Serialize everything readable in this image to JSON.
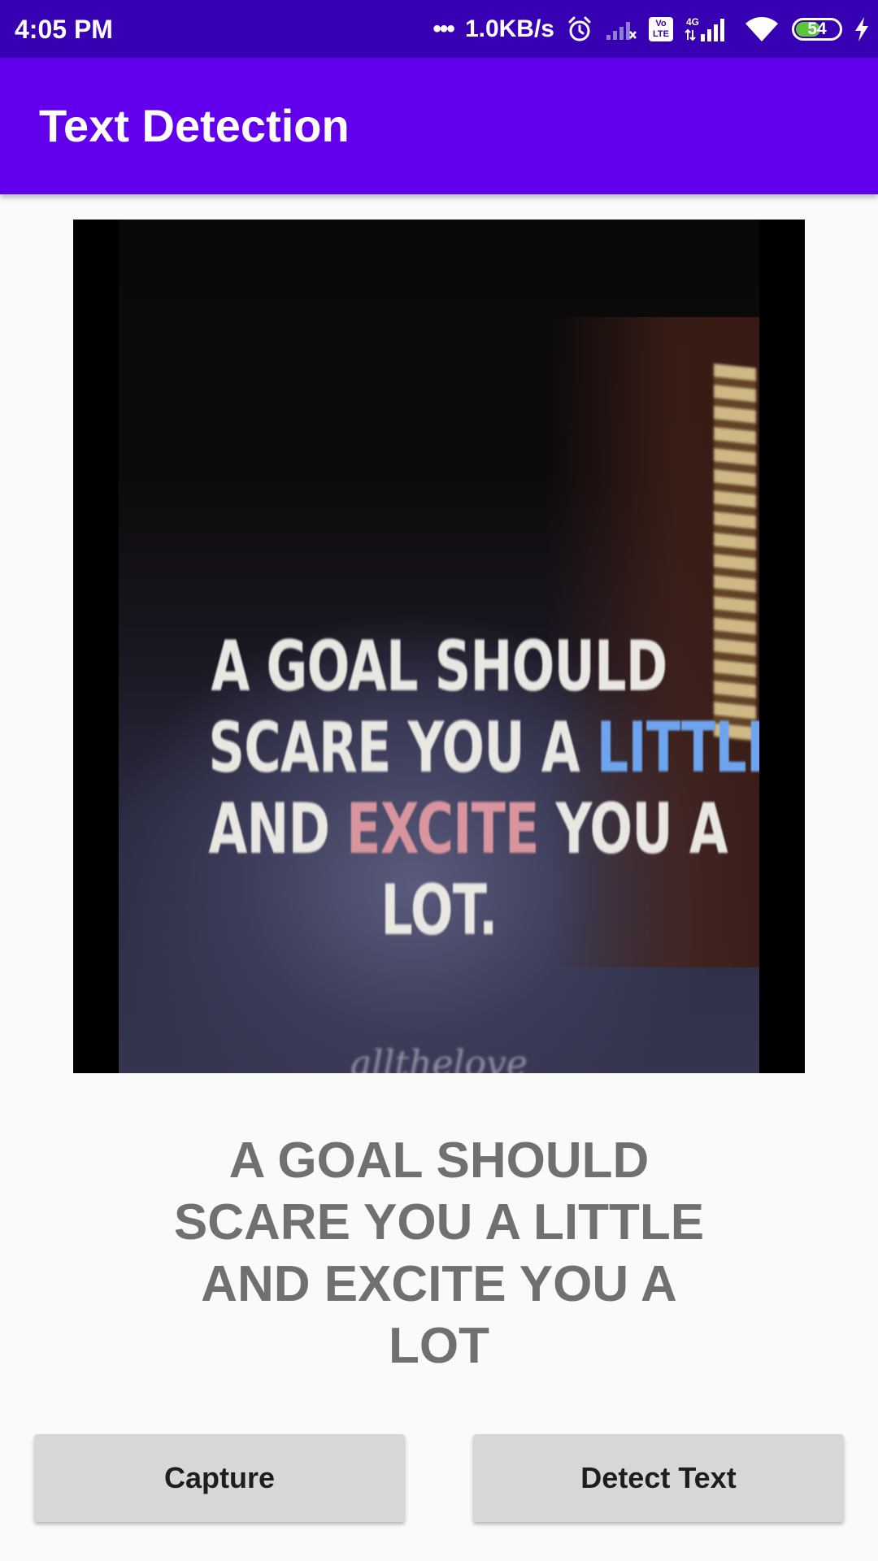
{
  "status_bar": {
    "time": "4:05 PM",
    "dots": "•••",
    "network_speed": "1.0KB/s",
    "network_type": "4G",
    "volte": "Vo LTE",
    "battery_level": "54",
    "icons": [
      "alarm-icon",
      "signal-x-icon",
      "volte-icon",
      "signal-4g-icon",
      "wifi-icon",
      "battery-icon",
      "charging-icon"
    ],
    "background_color": "#3700b3"
  },
  "app_bar": {
    "title": "Text Detection",
    "background_color": "#6200ee"
  },
  "photo": {
    "lines": [
      [
        {
          "text": "A GOAL SHOULD",
          "tone": "white"
        }
      ],
      [
        {
          "text": "SCARE YOU A ",
          "tone": "white"
        },
        {
          "text": "LITTLE",
          "tone": "blue"
        }
      ],
      [
        {
          "text": "AND ",
          "tone": "white"
        },
        {
          "text": "EXCITE",
          "tone": "pink"
        },
        {
          "text": " YOU A",
          "tone": "white"
        }
      ],
      [
        {
          "text": "LOT.",
          "tone": "white"
        }
      ]
    ],
    "script_text": "allthelove"
  },
  "result": {
    "lines": [
      "A GOAL SHOULD",
      "SCARE YOU A LITTLE",
      "AND EXCITE YOU A",
      "LOT"
    ],
    "color": "#707070"
  },
  "buttons": {
    "capture_label": "Capture",
    "detect_label": "Detect Text"
  }
}
